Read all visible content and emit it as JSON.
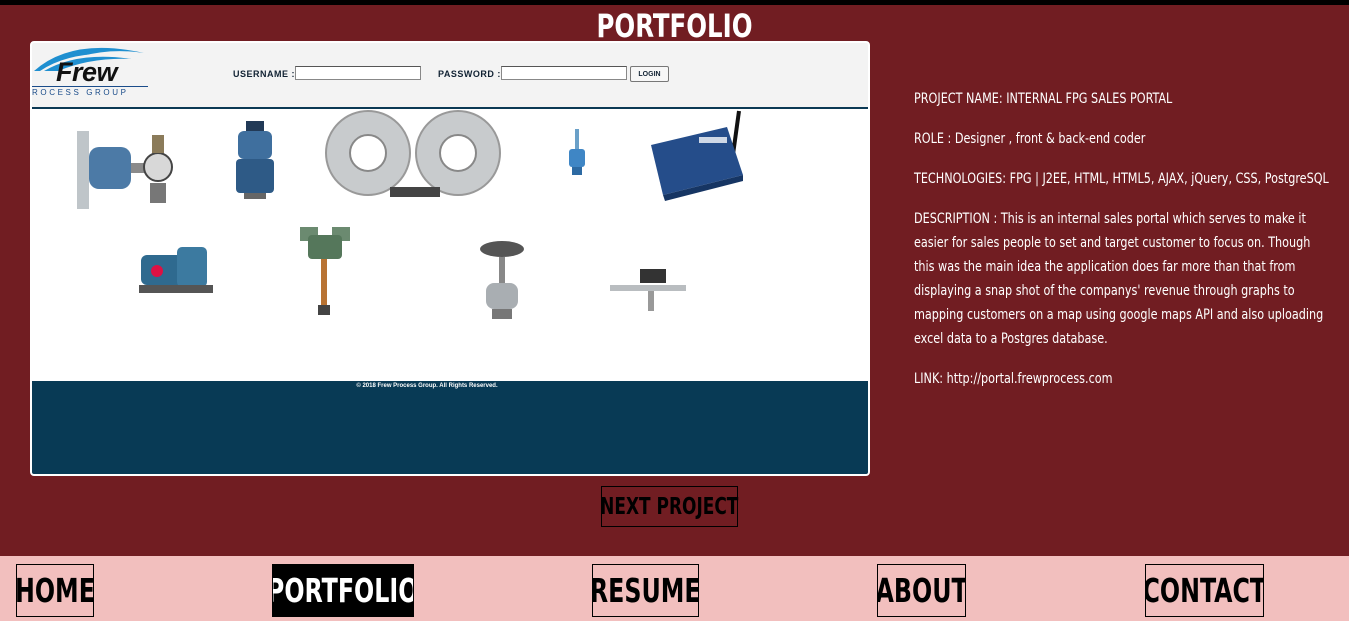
{
  "page": {
    "title": "PORTFOLIO"
  },
  "screenshot": {
    "logo_word": "Frew",
    "logo_sub": "ROCESS GROUP",
    "username_label": "USERNAME :",
    "password_label": "PASSWORD :",
    "username_value": "",
    "password_value": "",
    "login_label": "LOGIN",
    "copyright": "© 2018 Frew Process Group. All Rights Reserved."
  },
  "project": {
    "name": "PROJECT NAME: INTERNAL FPG SALES PORTAL",
    "role": "ROLE : Designer , front & back-end coder",
    "technologies": "TECHNOLOGIES: FPG | J2EE, HTML, HTML5, AJAX, jQuery, CSS, PostgreSQL",
    "description": "DESCRIPTION : This is an internal sales portal which serves to make it easier for sales people to set and target customer to focus on. Though this was the main idea the application does far more than that from displaying a snap shot of the companys' revenue through graphs to mapping customers on a map using google maps API and also uploading excel data to a Postgres database.",
    "link": "LINK: http://portal.frewprocess.com"
  },
  "next_button": "NEXT PROJECT",
  "nav": {
    "items": [
      {
        "label": "HOME",
        "active": false
      },
      {
        "label": "PORTFOLIO",
        "active": true
      },
      {
        "label": "RESUME",
        "active": false
      },
      {
        "label": "ABOUT",
        "active": false
      },
      {
        "label": "CONTACT",
        "active": false
      }
    ]
  },
  "colors": {
    "background": "#711d22",
    "nav_background": "#f2bfbe",
    "footer_navy": "#083a55",
    "active_nav": "#000000"
  }
}
